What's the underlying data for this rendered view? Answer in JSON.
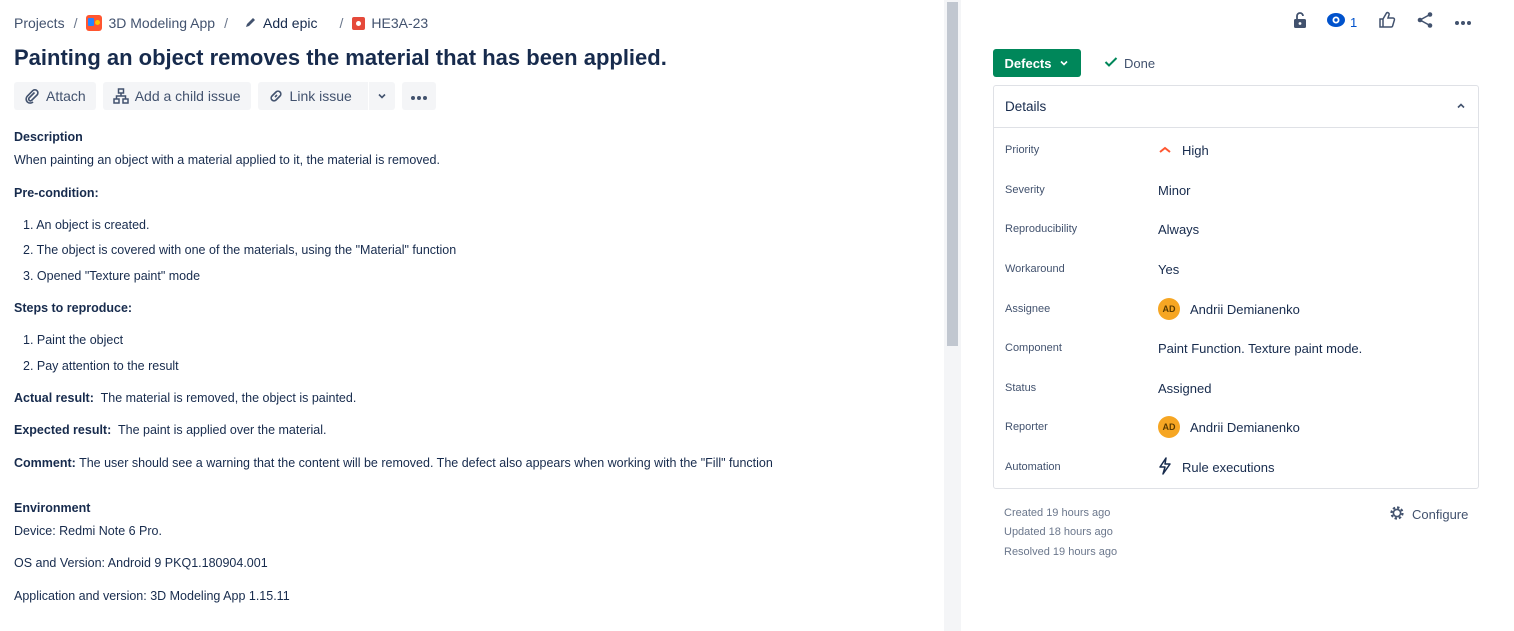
{
  "breadcrumbs": {
    "projects": "Projects",
    "project": "3D Modeling App",
    "add_epic": "Add epic",
    "issue_key": "HE3A-23"
  },
  "issue": {
    "title": "Painting an object removes the material that has been applied."
  },
  "toolbar": {
    "attach": "Attach",
    "add_child": "Add a child issue",
    "link_issue": "Link issue"
  },
  "description": {
    "heading": "Description",
    "summary": "When painting an object with a material applied to it, the material is removed.",
    "precondition_label": "Pre-condition:",
    "preconditions": [
      "1.  An object is created.",
      "2.  The object is covered with one of the materials, using the \"Material\" function",
      "3.  Opened \"Texture paint\" mode"
    ],
    "steps_label": "Steps to reproduce:",
    "steps": [
      "1.  Paint the object",
      "2.  Pay attention to the result"
    ],
    "actual_label": "Actual result:",
    "actual_value": "The material is removed, the object is painted.",
    "expected_label": "Expected result:",
    "expected_value": "The paint is applied over the material.",
    "comment_label": "Comment:",
    "comment_value": "The user should see a warning that the content will be removed. The defect also appears when working with the \"Fill\" function"
  },
  "environment": {
    "heading": "Environment",
    "device": "Device: Redmi Note 6 Pro.",
    "os": "OS and Version: Android 9 PKQ1.180904.001",
    "app": "Application and version: 3D Modeling App 1.15.11"
  },
  "header_actions": {
    "watch_count": "1"
  },
  "status": {
    "button_label": "Defects",
    "resolution": "Done",
    "button_color": "#00875a"
  },
  "details": {
    "heading": "Details",
    "fields": [
      {
        "label": "Priority",
        "value": "High"
      },
      {
        "label": "Severity",
        "value": "Minor"
      },
      {
        "label": "Reproducibility",
        "value": "Always"
      },
      {
        "label": "Workaround",
        "value": "Yes"
      },
      {
        "label": "Assignee",
        "value": "Andrii Demianenko",
        "avatar": "AD"
      },
      {
        "label": "Component",
        "value": "Paint Function. Texture paint mode."
      },
      {
        "label": "Status",
        "value": "Assigned"
      },
      {
        "label": "Reporter",
        "value": "Andrii Demianenko",
        "avatar": "AD"
      },
      {
        "label": "Automation",
        "value": "Rule executions"
      }
    ]
  },
  "meta": {
    "created": "Created 19 hours ago",
    "updated": "Updated 18 hours ago",
    "resolved": "Resolved 19 hours ago",
    "configure": "Configure"
  }
}
